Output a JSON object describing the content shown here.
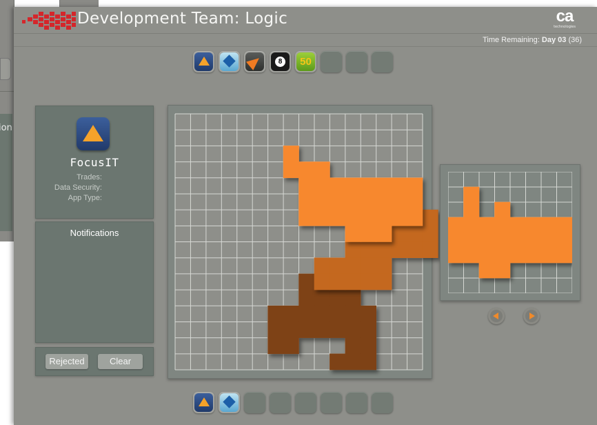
{
  "background_window": {
    "partial_label": "ion"
  },
  "header": {
    "title": "Development Team: Logic",
    "brand_mark": "ca",
    "brand_sub": "technologies",
    "time_label": "Time Remaining:",
    "time_value": "Day 03",
    "time_extra": "(36)"
  },
  "top_toolbar": {
    "slots": [
      {
        "icon": "focusit-triangle-icon",
        "filled": true
      },
      {
        "icon": "blue-diamond-icon",
        "filled": true
      },
      {
        "icon": "orange-arrow-icon",
        "filled": true
      },
      {
        "icon": "eight-ball-icon",
        "filled": true,
        "label": "8"
      },
      {
        "icon": "green-number-icon",
        "filled": true,
        "label": "50"
      },
      {
        "icon": "empty-slot",
        "filled": false
      },
      {
        "icon": "empty-slot",
        "filled": false
      },
      {
        "icon": "empty-slot",
        "filled": false
      }
    ]
  },
  "bottom_toolbar": {
    "slots": [
      {
        "icon": "focusit-triangle-icon",
        "filled": true
      },
      {
        "icon": "blue-diamond-icon",
        "filled": true
      },
      {
        "icon": "empty-slot",
        "filled": false
      },
      {
        "icon": "empty-slot",
        "filled": false
      },
      {
        "icon": "empty-slot",
        "filled": false
      },
      {
        "icon": "empty-slot",
        "filled": false
      },
      {
        "icon": "empty-slot",
        "filled": false
      },
      {
        "icon": "empty-slot",
        "filled": false
      }
    ]
  },
  "app_info": {
    "name": "FocusIT",
    "trades_label": "Trades:",
    "data_security_label": "Data Security:",
    "app_type_label": "App Type:"
  },
  "notifications": {
    "title": "Notifications"
  },
  "actions": {
    "rejected_label": "Rejected",
    "clear_label": "Clear"
  },
  "colors": {
    "piece_light": "#f7882e",
    "piece_mid": "#c4681f",
    "piece_dark": "#7e4216",
    "brand_red": "#d4262b",
    "app_icon_blue": "#2f4f8a",
    "app_icon_orange": "#f5a22a"
  },
  "board": {
    "grid_cols": 16,
    "grid_rows": 16,
    "pieces": [
      {
        "shade": "light",
        "cells": [
          [
            7,
            2
          ],
          [
            7,
            3
          ],
          [
            8,
            3
          ],
          [
            9,
            3
          ],
          [
            8,
            4
          ],
          [
            9,
            4
          ],
          [
            10,
            4
          ],
          [
            11,
            4
          ],
          [
            12,
            4
          ],
          [
            13,
            4
          ],
          [
            14,
            4
          ],
          [
            15,
            4
          ],
          [
            8,
            5
          ],
          [
            9,
            5
          ],
          [
            10,
            5
          ],
          [
            11,
            5
          ],
          [
            12,
            5
          ],
          [
            13,
            5
          ],
          [
            14,
            5
          ],
          [
            15,
            5
          ],
          [
            8,
            6
          ],
          [
            9,
            6
          ],
          [
            10,
            6
          ],
          [
            11,
            6
          ],
          [
            12,
            6
          ],
          [
            13,
            6
          ],
          [
            14,
            6
          ],
          [
            15,
            6
          ],
          [
            11,
            7
          ],
          [
            12,
            7
          ],
          [
            13,
            7
          ]
        ]
      },
      {
        "shade": "mid",
        "cells": [
          [
            13,
            6
          ],
          [
            14,
            6
          ],
          [
            15,
            6
          ],
          [
            16,
            6
          ],
          [
            13,
            7
          ],
          [
            14,
            7
          ],
          [
            15,
            7
          ],
          [
            16,
            7
          ],
          [
            11,
            8
          ],
          [
            12,
            8
          ],
          [
            13,
            8
          ],
          [
            14,
            8
          ],
          [
            15,
            8
          ],
          [
            16,
            8
          ],
          [
            9,
            9
          ],
          [
            10,
            9
          ],
          [
            11,
            9
          ],
          [
            12,
            9
          ],
          [
            13,
            9
          ],
          [
            9,
            10
          ],
          [
            10,
            10
          ],
          [
            11,
            10
          ],
          [
            12,
            10
          ],
          [
            13,
            10
          ]
        ]
      },
      {
        "shade": "dark",
        "cells": [
          [
            8,
            10
          ],
          [
            9,
            10
          ],
          [
            10,
            10
          ],
          [
            8,
            11
          ],
          [
            9,
            11
          ],
          [
            10,
            11
          ],
          [
            11,
            11
          ],
          [
            6,
            12
          ],
          [
            7,
            12
          ],
          [
            8,
            12
          ],
          [
            9,
            12
          ],
          [
            10,
            12
          ],
          [
            11,
            12
          ],
          [
            12,
            12
          ],
          [
            6,
            13
          ],
          [
            7,
            13
          ],
          [
            8,
            13
          ],
          [
            9,
            13
          ],
          [
            10,
            13
          ],
          [
            11,
            13
          ],
          [
            12,
            13
          ],
          [
            6,
            14
          ],
          [
            7,
            14
          ],
          [
            11,
            14
          ],
          [
            12,
            14
          ],
          [
            10,
            15
          ],
          [
            11,
            15
          ],
          [
            12,
            15
          ]
        ]
      }
    ]
  },
  "preview": {
    "grid_cols": 8,
    "grid_rows": 8,
    "cells": [
      [
        1,
        1
      ],
      [
        1,
        2
      ],
      [
        1,
        3
      ],
      [
        1,
        4
      ],
      [
        3,
        2
      ],
      [
        3,
        3
      ],
      [
        3,
        4
      ],
      [
        0,
        3
      ],
      [
        0,
        4
      ],
      [
        0,
        5
      ],
      [
        1,
        5
      ],
      [
        2,
        3
      ],
      [
        2,
        4
      ],
      [
        2,
        5
      ],
      [
        2,
        6
      ],
      [
        3,
        5
      ],
      [
        3,
        6
      ],
      [
        4,
        3
      ],
      [
        4,
        4
      ],
      [
        4,
        5
      ],
      [
        5,
        3
      ],
      [
        5,
        4
      ],
      [
        5,
        5
      ],
      [
        6,
        3
      ],
      [
        6,
        4
      ],
      [
        6,
        5
      ],
      [
        7,
        3
      ],
      [
        7,
        4
      ],
      [
        7,
        5
      ]
    ]
  }
}
